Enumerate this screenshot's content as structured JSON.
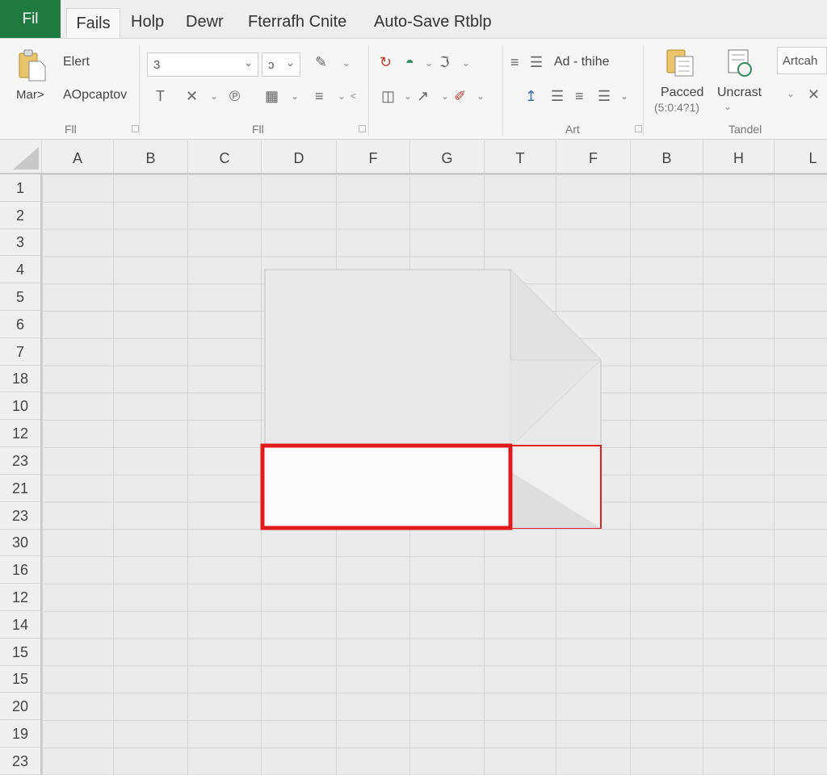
{
  "tabs": {
    "file": "Fil",
    "items": [
      "Fails",
      "Holp",
      "Dewr",
      "Fterrafh Cnite",
      "Auto-Save Rtblp"
    ]
  },
  "ribbon": {
    "clipboard": {
      "paste_label": "Mar>",
      "cut_label": "Elert",
      "options_label": "AOpcaptov",
      "group_label": "Fll"
    },
    "font": {
      "font_value": "3",
      "size_value": "ɔ",
      "group_label": "Fll"
    },
    "alignment": {
      "wrap_label": "Ad - thihe",
      "group_label": "Art"
    },
    "cells": {
      "paste_label": "Pacced",
      "paste_sub": "(5:0:4?1)",
      "unstack_label": "Uncrast",
      "group_label": "Tandel"
    },
    "search": {
      "placeholder": "Artcah"
    }
  },
  "grid": {
    "columns": [
      "A",
      "B",
      "C",
      "D",
      "F",
      "G",
      "T",
      "F",
      "B",
      "H",
      "L"
    ],
    "rows": [
      "1",
      "2",
      "3",
      "4",
      "5",
      "6",
      "7",
      "18",
      "10",
      "12",
      "23",
      "21",
      "23",
      "30",
      "16",
      "12",
      "14",
      "15",
      "15",
      "20",
      "19",
      "23"
    ]
  },
  "colors": {
    "accent": "#1e7a3e",
    "selection": "#e01b1b"
  }
}
